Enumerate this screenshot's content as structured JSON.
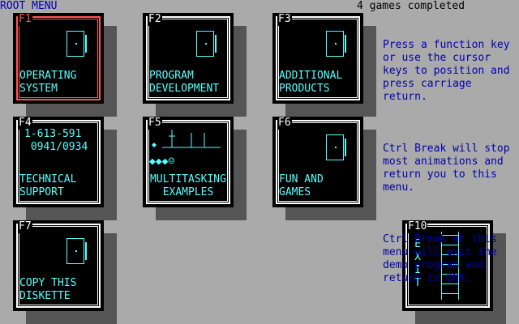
{
  "header": {
    "title": "ROOT MENU",
    "status": "4 games completed"
  },
  "colors": {
    "background": "#aaaaaa",
    "tile": "#000000",
    "frame": "#ffffff",
    "accent": "#55ffff",
    "selected": "#ff5555",
    "help_text": "#0000aa"
  },
  "tiles": {
    "f1": {
      "key": "F1",
      "label": "OPERATING\nSYSTEM",
      "icon": "door-icon",
      "selected": true
    },
    "f2": {
      "key": "F2",
      "label": "PROGRAM\nDEVELOPMENT",
      "icon": "door-icon"
    },
    "f3": {
      "key": "F3",
      "label": "ADDITIONAL\nPRODUCTS",
      "icon": "door-icon"
    },
    "f4": {
      "key": "F4",
      "phone": "1-613-591\n 0941/0934",
      "label": "TECHNICAL\nSUPPORT"
    },
    "f5": {
      "key": "F5",
      "symbols": "◆◆◆☺",
      "label": "MULTITASKING\nEXAMPLES",
      "icon": "multitasking-icon"
    },
    "f6": {
      "key": "F6",
      "label": "FUN AND\nGAMES",
      "icon": "door-icon"
    },
    "f7": {
      "key": "F7",
      "label": "COPY THIS\nDISKETTE",
      "icon": "door-icon"
    },
    "f10": {
      "key": "F10",
      "label": "E\nX\nI\nT",
      "icon": "ladder-icon"
    }
  },
  "help": {
    "p1": "Press a function key\nor use the cursor\nkeys to position and\npress carriage\nreturn.",
    "p2": "Ctrl Break will stop\nmost animations and\nreturn you to this\nmenu.",
    "p3": "Ctrl Break at this\nmenu will exit the\ndemo program and\nreturn to QNX."
  }
}
